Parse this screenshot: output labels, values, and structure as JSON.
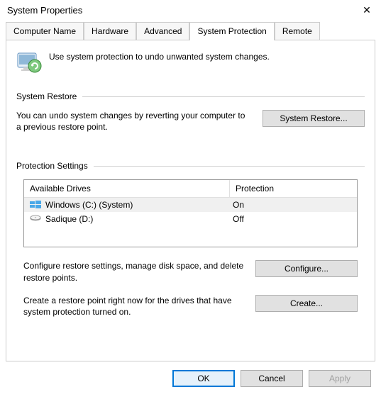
{
  "window": {
    "title": "System Properties"
  },
  "tabs": {
    "computer_name": "Computer Name",
    "hardware": "Hardware",
    "advanced": "Advanced",
    "system_protection": "System Protection",
    "remote": "Remote"
  },
  "intro": "Use system protection to undo unwanted system changes.",
  "restore": {
    "header": "System Restore",
    "text": "You can undo system changes by reverting your computer to a previous restore point.",
    "button": "System Restore..."
  },
  "protection": {
    "header": "Protection Settings",
    "col_drives": "Available Drives",
    "col_protection": "Protection",
    "drives": [
      {
        "name": "Windows (C:) (System)",
        "status": "On"
      },
      {
        "name": "Sadique (D:)",
        "status": "Off"
      }
    ],
    "configure_text": "Configure restore settings, manage disk space, and delete restore points.",
    "configure_button": "Configure...",
    "create_text": "Create a restore point right now for the drives that have system protection turned on.",
    "create_button": "Create..."
  },
  "footer": {
    "ok": "OK",
    "cancel": "Cancel",
    "apply": "Apply"
  }
}
